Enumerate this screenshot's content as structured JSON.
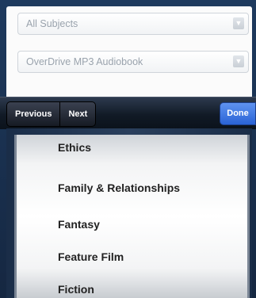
{
  "form": {
    "subject_select": {
      "value": "All Subjects"
    },
    "format_select": {
      "value": "OverDrive MP3 Audiobook"
    }
  },
  "toolbar": {
    "previous_label": "Previous",
    "next_label": "Next",
    "done_label": "Done"
  },
  "picker": {
    "items": [
      "Ethics",
      "Family & Relationships",
      "Fantasy",
      "Feature Film",
      "Fiction"
    ]
  },
  "colors": {
    "done_button": "#2a63d6",
    "toolbar_dark": "#111a26",
    "page_background": "#1e3a5e"
  }
}
